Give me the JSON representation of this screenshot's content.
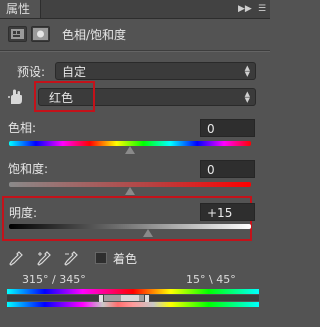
{
  "panel": {
    "tab_label": "属性",
    "title": "色相/饱和度"
  },
  "preset": {
    "label": "预设:",
    "value": "自定"
  },
  "channel": {
    "value": "红色"
  },
  "hue": {
    "label": "色相:",
    "value": "0",
    "level_fraction": 0.5
  },
  "saturation": {
    "label": "饱和度:",
    "value": "0",
    "level_fraction": 0.5
  },
  "lightness": {
    "label": "明度:",
    "value": "+15",
    "level_fraction": 0.575
  },
  "colorize": {
    "label": "着色",
    "checked": false
  },
  "range": {
    "left": "315° / 345°",
    "right": "15° \\ 45°"
  },
  "colors": {
    "panel_bg": "#535353",
    "annotation_red": "#c4121a"
  },
  "icons": [
    "adjustment-layer-icon",
    "mask-icon",
    "hand-target-icon",
    "eyedropper-icon",
    "eyedropper-plus-icon",
    "eyedropper-minus-icon"
  ]
}
